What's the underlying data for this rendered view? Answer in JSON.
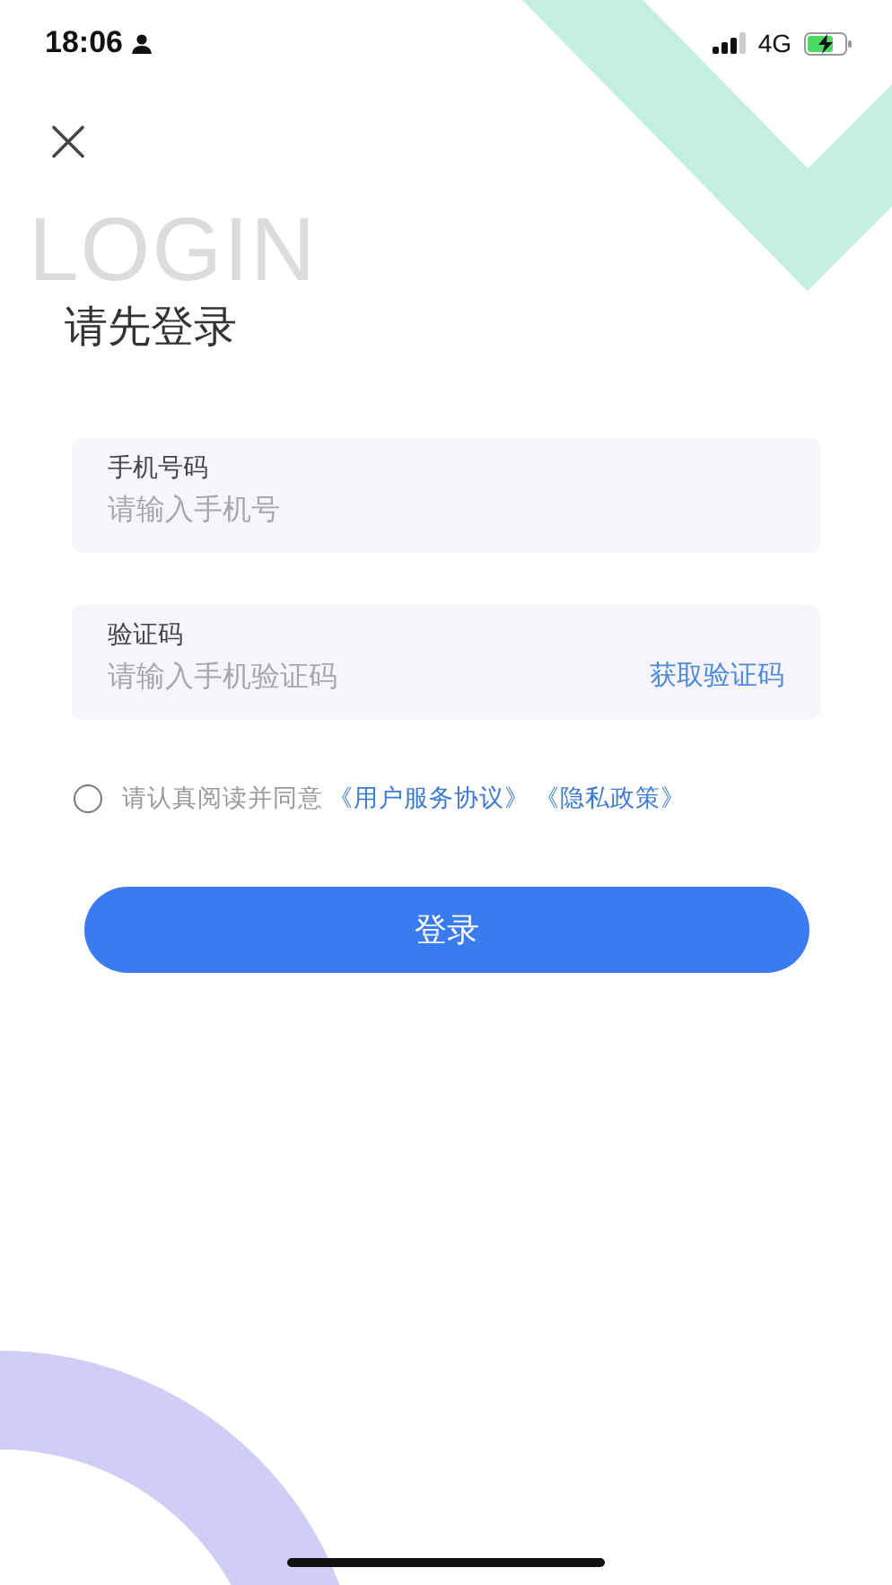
{
  "status_bar": {
    "time": "18:06",
    "network": "4G",
    "charging": true
  },
  "background_title": "LOGIN",
  "title": "请先登录",
  "fields": [
    {
      "label": "手机号码",
      "placeholder": "请输入手机号"
    },
    {
      "label": "验证码",
      "placeholder": "请输入手机验证码",
      "action": "获取验证码"
    }
  ],
  "agreement": {
    "checked": false,
    "text": "请认真阅读并同意",
    "links": [
      "《用户服务协议》",
      "《隐私政策》"
    ]
  },
  "login_button": "登录"
}
